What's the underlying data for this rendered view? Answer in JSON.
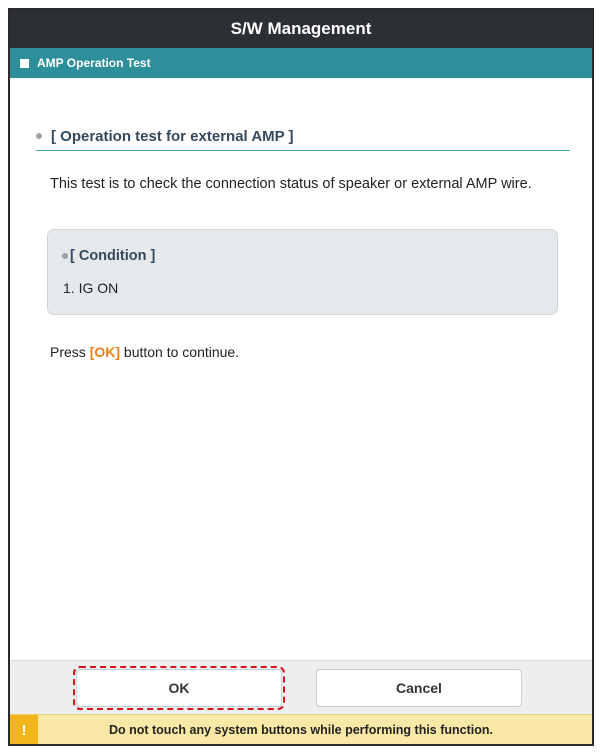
{
  "window": {
    "title": "S/W Management"
  },
  "header": {
    "section_label": "AMP Operation Test"
  },
  "main": {
    "section_title": "[ Operation test for external AMP ]",
    "description": "This test is to check the connection status of speaker or external AMP wire.",
    "condition": {
      "title": "[ Condition ]",
      "items": [
        "1. IG ON"
      ]
    },
    "instruction": {
      "prefix": "Press ",
      "highlight": "[OK]",
      "suffix": " button to continue."
    }
  },
  "buttons": {
    "ok_label": "OK",
    "cancel_label": "Cancel"
  },
  "warning": {
    "icon": "exclamation-icon",
    "icon_glyph": "!",
    "text": "Do not touch any system buttons while performing this function."
  },
  "colors": {
    "titlebar": "#2c3035",
    "subbar": "#2d8f9a",
    "highlight": "#f07d16",
    "warning_bg": "#fae8a6",
    "warning_icon": "#f3b51c",
    "focus_outline": "#d7141a"
  }
}
